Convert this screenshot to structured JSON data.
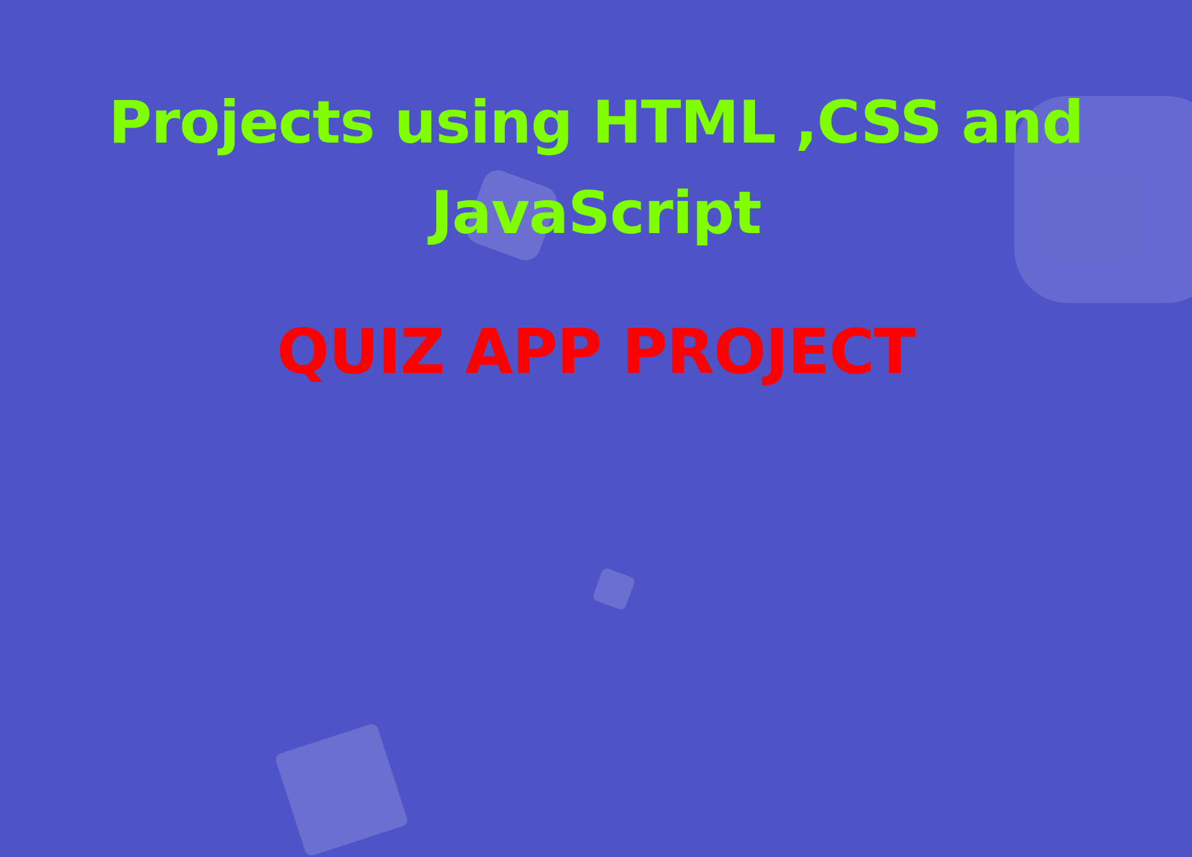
{
  "page": {
    "title": "Projects using HTML ,CSS and JavaScript",
    "subtitle": "QUIZ APP PROJECT"
  },
  "colors": {
    "background": "#4e54c8",
    "title": "#7fff00",
    "subtitle": "#ff0000",
    "decor": "rgba(255,255,255,0.13)"
  }
}
